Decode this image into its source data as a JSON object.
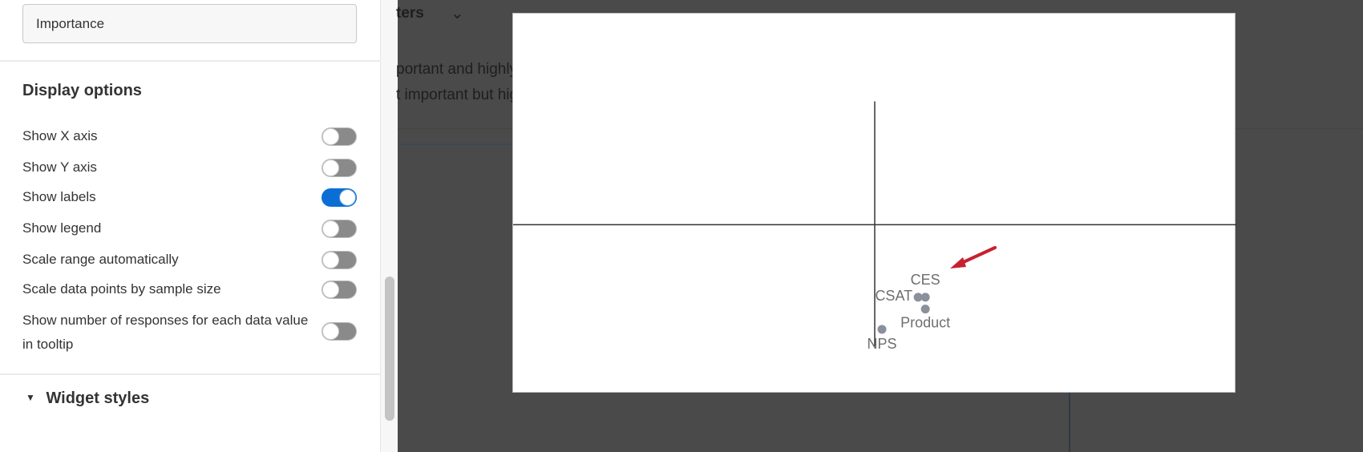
{
  "sidebar": {
    "importance_field": "Importance",
    "display_options_title": "Display options",
    "toggles": [
      {
        "label": "Show X axis",
        "on": false
      },
      {
        "label": "Show Y axis",
        "on": false
      },
      {
        "label": "Show labels",
        "on": true
      },
      {
        "label": "Show legend",
        "on": false
      },
      {
        "label": "Scale range automatically",
        "on": false
      },
      {
        "label": "Scale data points by sample size",
        "on": false
      },
      {
        "label": "Show number of responses for each data value in tooltip",
        "on": false
      }
    ],
    "widget_styles_title": "Widget styles",
    "widget_styles_icon": "caret-down-icon"
  },
  "background": {
    "filters_label": "ters",
    "line1": "portant and highly",
    "line2": "t important but hig"
  },
  "colors": {
    "accent": "#0b6ed4",
    "point": "#8a909c",
    "arrow": "#c8202f"
  },
  "chart_data": {
    "type": "scatter",
    "xlim": [
      -1,
      1
    ],
    "ylim": [
      -1,
      1.25
    ],
    "x_axis_span": [
      -1,
      1
    ],
    "y_axis_span": [
      -0.72,
      0.73
    ],
    "points": [
      {
        "label": "CES",
        "x": 0.14,
        "y": -0.43
      },
      {
        "label": "CSAT",
        "x": 0.12,
        "y": -0.43
      },
      {
        "label": "Product",
        "x": 0.14,
        "y": -0.5
      },
      {
        "label": "NPS",
        "x": 0.02,
        "y": -0.62
      }
    ],
    "legend": "none",
    "grid": false,
    "annotation": "arrow pointing to CES"
  }
}
